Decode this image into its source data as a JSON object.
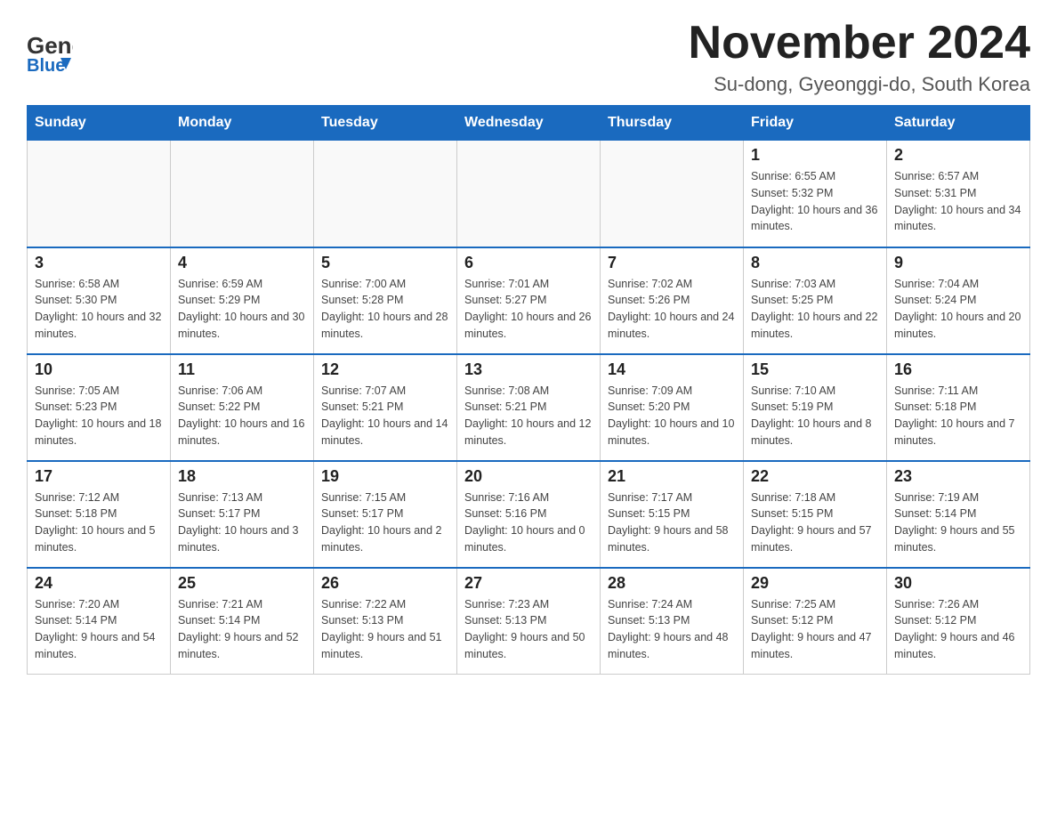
{
  "header": {
    "logo_text_general": "General",
    "logo_text_blue": "Blue",
    "main_title": "November 2024",
    "subtitle": "Su-dong, Gyeonggi-do, South Korea"
  },
  "calendar": {
    "days_of_week": [
      "Sunday",
      "Monday",
      "Tuesday",
      "Wednesday",
      "Thursday",
      "Friday",
      "Saturday"
    ],
    "weeks": [
      {
        "days": [
          {
            "number": "",
            "info": ""
          },
          {
            "number": "",
            "info": ""
          },
          {
            "number": "",
            "info": ""
          },
          {
            "number": "",
            "info": ""
          },
          {
            "number": "",
            "info": ""
          },
          {
            "number": "1",
            "info": "Sunrise: 6:55 AM\nSunset: 5:32 PM\nDaylight: 10 hours and 36 minutes."
          },
          {
            "number": "2",
            "info": "Sunrise: 6:57 AM\nSunset: 5:31 PM\nDaylight: 10 hours and 34 minutes."
          }
        ]
      },
      {
        "days": [
          {
            "number": "3",
            "info": "Sunrise: 6:58 AM\nSunset: 5:30 PM\nDaylight: 10 hours and 32 minutes."
          },
          {
            "number": "4",
            "info": "Sunrise: 6:59 AM\nSunset: 5:29 PM\nDaylight: 10 hours and 30 minutes."
          },
          {
            "number": "5",
            "info": "Sunrise: 7:00 AM\nSunset: 5:28 PM\nDaylight: 10 hours and 28 minutes."
          },
          {
            "number": "6",
            "info": "Sunrise: 7:01 AM\nSunset: 5:27 PM\nDaylight: 10 hours and 26 minutes."
          },
          {
            "number": "7",
            "info": "Sunrise: 7:02 AM\nSunset: 5:26 PM\nDaylight: 10 hours and 24 minutes."
          },
          {
            "number": "8",
            "info": "Sunrise: 7:03 AM\nSunset: 5:25 PM\nDaylight: 10 hours and 22 minutes."
          },
          {
            "number": "9",
            "info": "Sunrise: 7:04 AM\nSunset: 5:24 PM\nDaylight: 10 hours and 20 minutes."
          }
        ]
      },
      {
        "days": [
          {
            "number": "10",
            "info": "Sunrise: 7:05 AM\nSunset: 5:23 PM\nDaylight: 10 hours and 18 minutes."
          },
          {
            "number": "11",
            "info": "Sunrise: 7:06 AM\nSunset: 5:22 PM\nDaylight: 10 hours and 16 minutes."
          },
          {
            "number": "12",
            "info": "Sunrise: 7:07 AM\nSunset: 5:21 PM\nDaylight: 10 hours and 14 minutes."
          },
          {
            "number": "13",
            "info": "Sunrise: 7:08 AM\nSunset: 5:21 PM\nDaylight: 10 hours and 12 minutes."
          },
          {
            "number": "14",
            "info": "Sunrise: 7:09 AM\nSunset: 5:20 PM\nDaylight: 10 hours and 10 minutes."
          },
          {
            "number": "15",
            "info": "Sunrise: 7:10 AM\nSunset: 5:19 PM\nDaylight: 10 hours and 8 minutes."
          },
          {
            "number": "16",
            "info": "Sunrise: 7:11 AM\nSunset: 5:18 PM\nDaylight: 10 hours and 7 minutes."
          }
        ]
      },
      {
        "days": [
          {
            "number": "17",
            "info": "Sunrise: 7:12 AM\nSunset: 5:18 PM\nDaylight: 10 hours and 5 minutes."
          },
          {
            "number": "18",
            "info": "Sunrise: 7:13 AM\nSunset: 5:17 PM\nDaylight: 10 hours and 3 minutes."
          },
          {
            "number": "19",
            "info": "Sunrise: 7:15 AM\nSunset: 5:17 PM\nDaylight: 10 hours and 2 minutes."
          },
          {
            "number": "20",
            "info": "Sunrise: 7:16 AM\nSunset: 5:16 PM\nDaylight: 10 hours and 0 minutes."
          },
          {
            "number": "21",
            "info": "Sunrise: 7:17 AM\nSunset: 5:15 PM\nDaylight: 9 hours and 58 minutes."
          },
          {
            "number": "22",
            "info": "Sunrise: 7:18 AM\nSunset: 5:15 PM\nDaylight: 9 hours and 57 minutes."
          },
          {
            "number": "23",
            "info": "Sunrise: 7:19 AM\nSunset: 5:14 PM\nDaylight: 9 hours and 55 minutes."
          }
        ]
      },
      {
        "days": [
          {
            "number": "24",
            "info": "Sunrise: 7:20 AM\nSunset: 5:14 PM\nDaylight: 9 hours and 54 minutes."
          },
          {
            "number": "25",
            "info": "Sunrise: 7:21 AM\nSunset: 5:14 PM\nDaylight: 9 hours and 52 minutes."
          },
          {
            "number": "26",
            "info": "Sunrise: 7:22 AM\nSunset: 5:13 PM\nDaylight: 9 hours and 51 minutes."
          },
          {
            "number": "27",
            "info": "Sunrise: 7:23 AM\nSunset: 5:13 PM\nDaylight: 9 hours and 50 minutes."
          },
          {
            "number": "28",
            "info": "Sunrise: 7:24 AM\nSunset: 5:13 PM\nDaylight: 9 hours and 48 minutes."
          },
          {
            "number": "29",
            "info": "Sunrise: 7:25 AM\nSunset: 5:12 PM\nDaylight: 9 hours and 47 minutes."
          },
          {
            "number": "30",
            "info": "Sunrise: 7:26 AM\nSunset: 5:12 PM\nDaylight: 9 hours and 46 minutes."
          }
        ]
      }
    ]
  }
}
